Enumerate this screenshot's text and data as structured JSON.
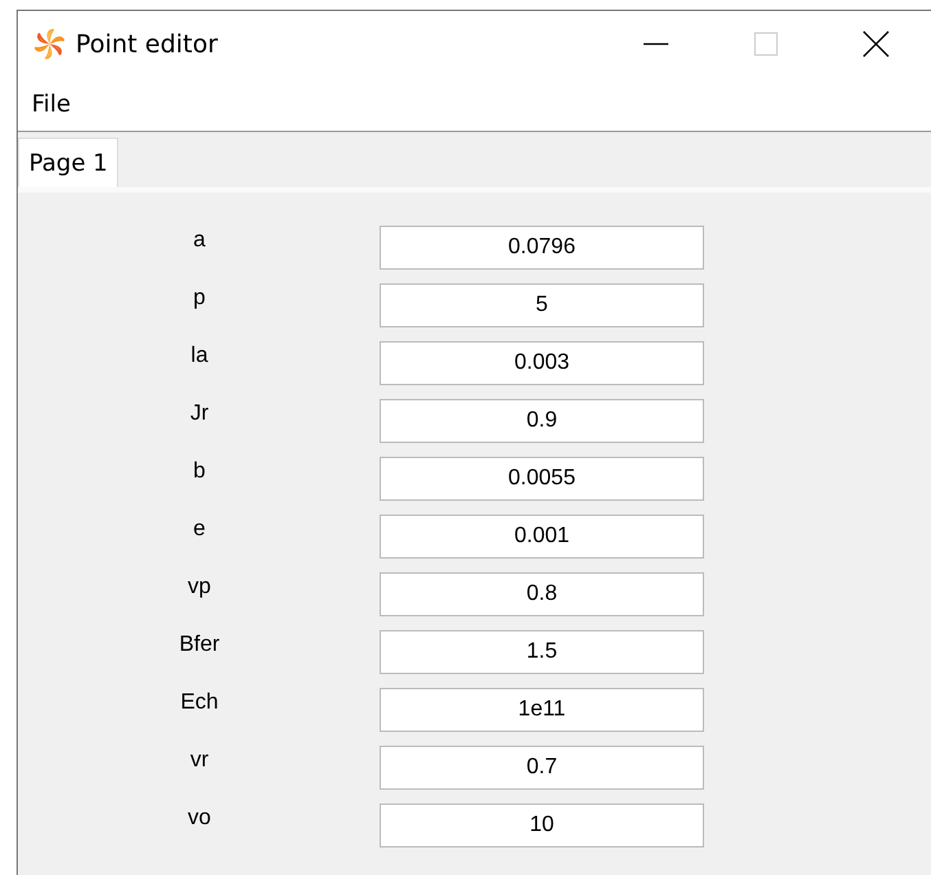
{
  "window": {
    "title": "Point editor"
  },
  "menu": [
    "File"
  ],
  "tabs": [
    {
      "label": "Page 1",
      "selected": true
    }
  ],
  "fields": [
    {
      "label": "a",
      "value": "0.0796"
    },
    {
      "label": "p",
      "value": "5"
    },
    {
      "label": "la",
      "value": "0.003"
    },
    {
      "label": "Jr",
      "value": "0.9"
    },
    {
      "label": "b",
      "value": "0.0055"
    },
    {
      "label": "e",
      "value": "0.001"
    },
    {
      "label": "vp",
      "value": "0.8"
    },
    {
      "label": "Bfer",
      "value": "1.5"
    },
    {
      "label": "Ech",
      "value": "1e11"
    },
    {
      "label": "vr",
      "value": "0.7"
    },
    {
      "label": "vo",
      "value": "10"
    }
  ]
}
